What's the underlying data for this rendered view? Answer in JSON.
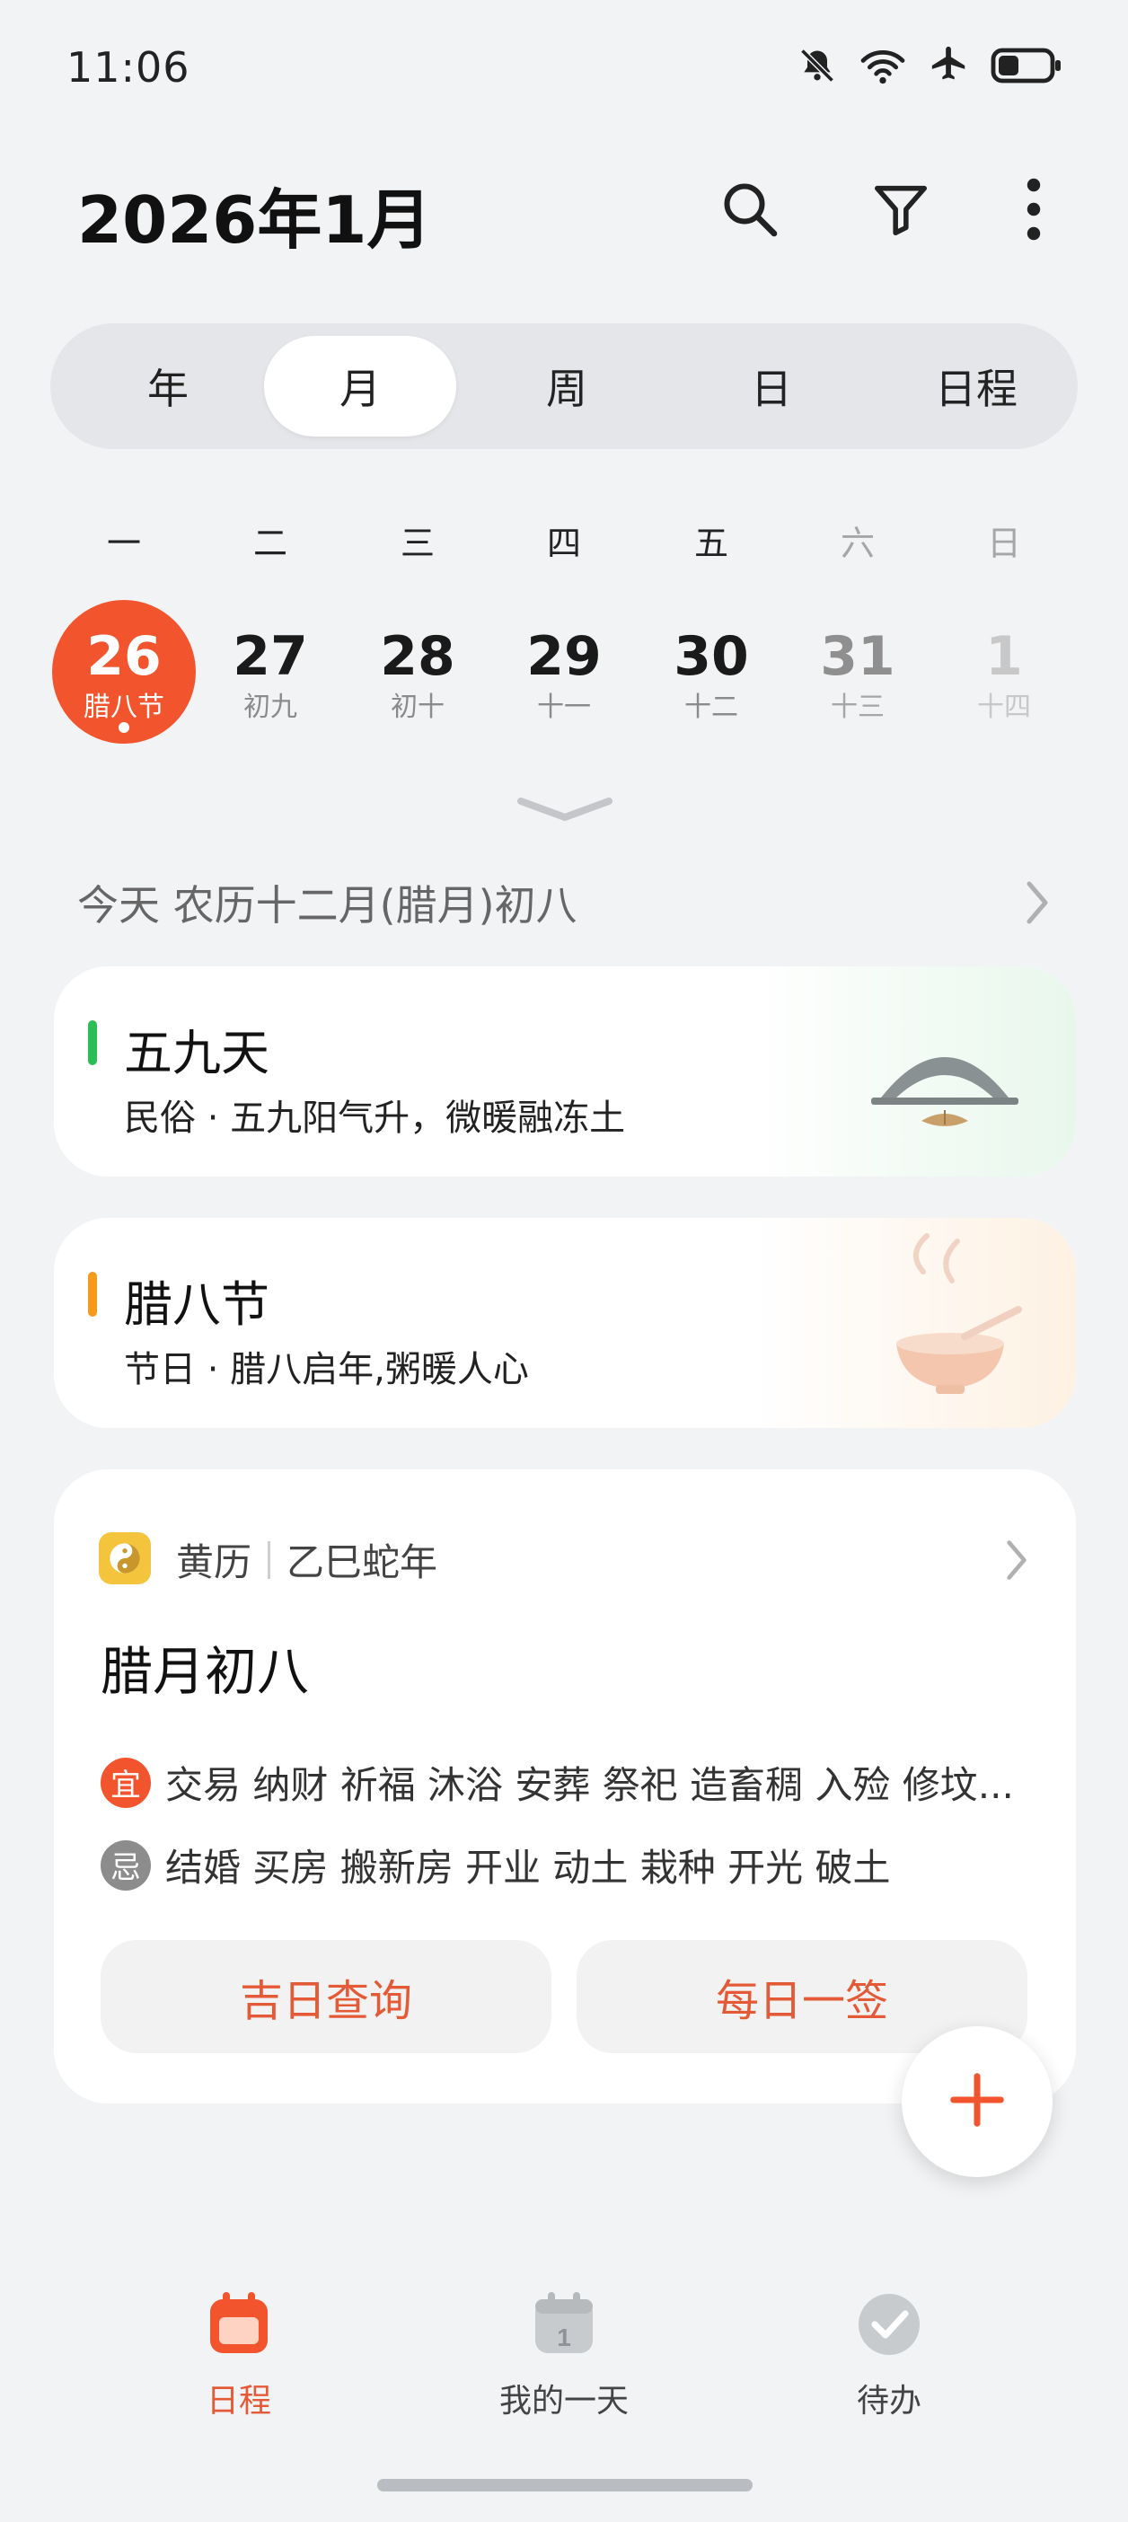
{
  "status_bar": {
    "time": "11:06",
    "icons": [
      "bell-off-icon",
      "wifi-icon",
      "airplane-icon",
      "battery-icon"
    ],
    "battery_level": 0.35
  },
  "header": {
    "title": "2026年1月",
    "actions": [
      "search-icon",
      "filter-icon",
      "more-vert-icon"
    ]
  },
  "view_tabs": {
    "items": [
      {
        "label": "年"
      },
      {
        "label": "月"
      },
      {
        "label": "周"
      },
      {
        "label": "日"
      },
      {
        "label": "日程"
      }
    ],
    "active": "月"
  },
  "week": {
    "weekdays": [
      "一",
      "二",
      "三",
      "四",
      "五",
      "六",
      "日"
    ],
    "days": [
      {
        "num": "26",
        "lunar": "腊八节",
        "today": true
      },
      {
        "num": "27",
        "lunar": "初九"
      },
      {
        "num": "28",
        "lunar": "初十"
      },
      {
        "num": "29",
        "lunar": "十一"
      },
      {
        "num": "30",
        "lunar": "十二"
      },
      {
        "num": "31",
        "lunar": "十三"
      },
      {
        "num": "1",
        "lunar": "十四"
      }
    ]
  },
  "lunar_line": {
    "text": "今天 农历十二月(腊月)初八"
  },
  "festivals": [
    {
      "title": "五九天",
      "subtitle": "民俗 · 五九阳气升，微暖融冻土",
      "accent": "#2bbd56"
    },
    {
      "title": "腊八节",
      "subtitle": "节日 · 腊八启年,粥暖人心",
      "accent": "#f59a1b"
    }
  ],
  "almanac": {
    "name": "黄历",
    "year": "乙巳蛇年",
    "date_title": "腊月初八",
    "yi_label": "宜",
    "yi_items": "交易 纳财 祈福 沐浴 安葬 祭祀 造畜稠 入殓 修坟...",
    "ji_label": "忌",
    "ji_items": "结婚 买房 搬新房 开业 动土 栽种 开光 破土",
    "button_lucky_day": "吉日查询",
    "button_daily_lot": "每日一签"
  },
  "bottom_nav": {
    "items": [
      {
        "label": "日程",
        "icon": "calendar-icon",
        "active": true
      },
      {
        "label": "我的一天",
        "icon": "calendar-day-icon",
        "badge": "1"
      },
      {
        "label": "待办",
        "icon": "check-circle-icon"
      }
    ]
  },
  "colors": {
    "accent": "#f2542d",
    "accent_text": "#e55a36",
    "background": "#f1f3f5",
    "yi_badge": "#f2542d",
    "ji_badge": "#8c8c8c"
  }
}
